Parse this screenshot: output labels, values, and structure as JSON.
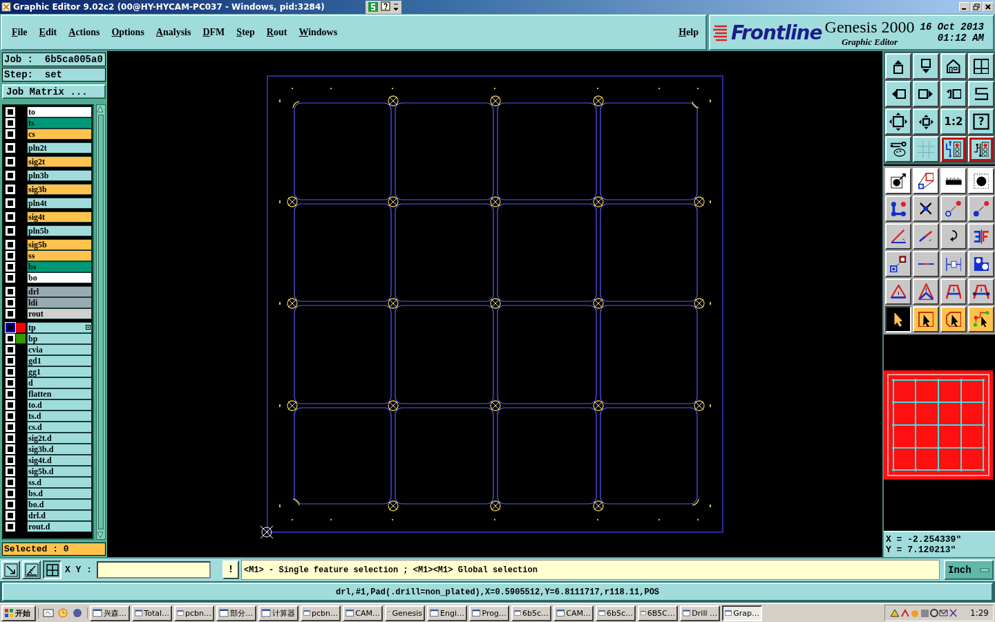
{
  "window": {
    "title": "Graphic Editor 9.02c2 (00@HY-HYCAM-PC037 - Windows, pid:3284)"
  },
  "menu": {
    "items": [
      "File",
      "Edit",
      "Actions",
      "Options",
      "Analysis",
      "DFM",
      "Step",
      "Rout",
      "Windows"
    ],
    "help": "Help"
  },
  "brand": {
    "logo": "Frontline",
    "product": "Genesis 2000",
    "subtitle": "Graphic Editor",
    "date": "16 Oct 2013",
    "time": "01:12 AM"
  },
  "job": {
    "job": "Job :  6b5ca005a0",
    "step": "Step:  set",
    "matrix_button": "Job Matrix ...",
    "selected": "Selected : 0"
  },
  "layer_groups": [
    {
      "layers": [
        {
          "name": "to",
          "color": "#ffffff",
          "checked": false
        },
        {
          "name": "ts",
          "color": "#009977",
          "checked": false
        },
        {
          "name": "cs",
          "color": "#ffc34d",
          "checked": false
        }
      ]
    },
    {
      "layers": [
        {
          "name": "pln2t",
          "color": "#a0dcdc",
          "checked": false
        }
      ]
    },
    {
      "layers": [
        {
          "name": "sig2t",
          "color": "#ffc34d",
          "checked": false
        }
      ]
    },
    {
      "layers": [
        {
          "name": "pln3b",
          "color": "#a0dcdc",
          "checked": false
        }
      ]
    },
    {
      "layers": [
        {
          "name": "sig3b",
          "color": "#ffc34d",
          "checked": false
        }
      ]
    },
    {
      "layers": [
        {
          "name": "pln4t",
          "color": "#a0dcdc",
          "checked": false
        }
      ]
    },
    {
      "layers": [
        {
          "name": "sig4t",
          "color": "#ffc34d",
          "checked": false
        }
      ]
    },
    {
      "layers": [
        {
          "name": "pln5b",
          "color": "#a0dcdc",
          "checked": false
        }
      ]
    },
    {
      "layers": [
        {
          "name": "sig5b",
          "color": "#ffc34d",
          "checked": false
        },
        {
          "name": "ss",
          "color": "#ffc34d",
          "checked": false
        },
        {
          "name": "bs",
          "color": "#009977",
          "checked": false
        },
        {
          "name": "bo",
          "color": "#ffffff",
          "checked": false
        }
      ]
    },
    {
      "layers": [
        {
          "name": "drl",
          "color": "#99aab0",
          "checked": false
        },
        {
          "name": "ldi",
          "color": "#99aab0",
          "checked": false
        },
        {
          "name": "rout",
          "color": "#d0d0d0",
          "checked": false
        }
      ]
    },
    {
      "layers": [
        {
          "name": "tp",
          "color": "#a0dcdc",
          "checked": false,
          "active": true,
          "swatch": {
            "color": "#ff0000"
          }
        },
        {
          "name": "bp",
          "color": "#a0dcdc",
          "checked": false,
          "active": false,
          "swatch": {
            "color": "#339900"
          }
        },
        {
          "name": "cvia",
          "color": "#a0dcdc",
          "checked": false
        },
        {
          "name": "gd1",
          "color": "#a0dcdc",
          "checked": false
        },
        {
          "name": "gg1",
          "color": "#a0dcdc",
          "checked": false
        },
        {
          "name": "d",
          "color": "#a0dcdc",
          "checked": false
        },
        {
          "name": "flatten",
          "color": "#a0dcdc",
          "checked": false
        },
        {
          "name": "to.d",
          "color": "#a0dcdc",
          "checked": false
        },
        {
          "name": "ts.d",
          "color": "#a0dcdc",
          "checked": false
        },
        {
          "name": "cs.d",
          "color": "#a0dcdc",
          "checked": false
        },
        {
          "name": "sig2t.d",
          "color": "#a0dcdc",
          "checked": false
        },
        {
          "name": "sig3b.d",
          "color": "#a0dcdc",
          "checked": false
        },
        {
          "name": "sig4t.d",
          "color": "#a0dcdc",
          "checked": false
        },
        {
          "name": "sig5b.d",
          "color": "#a0dcdc",
          "checked": false
        },
        {
          "name": "ss.d",
          "color": "#a0dcdc",
          "checked": false
        },
        {
          "name": "bs.d",
          "color": "#a0dcdc",
          "checked": false
        },
        {
          "name": "bo.d",
          "color": "#a0dcdc",
          "checked": false
        },
        {
          "name": "drl.d",
          "color": "#a0dcdc",
          "checked": false
        },
        {
          "name": "rout.d",
          "color": "#a0dcdc",
          "checked": false
        }
      ]
    }
  ],
  "tools": {
    "view": [
      {
        "kind": "pan-up",
        "on": false
      },
      {
        "kind": "pan-down",
        "on": false
      },
      {
        "kind": "home",
        "on": false
      },
      {
        "kind": "layout",
        "on": false
      },
      {
        "kind": "pan-left",
        "on": false
      },
      {
        "kind": "pan-right",
        "on": false
      },
      {
        "kind": "back",
        "on": false
      },
      {
        "kind": "route",
        "on": false
      },
      {
        "kind": "zoom-fit",
        "on": false
      },
      {
        "kind": "zoom-center",
        "on": false
      },
      {
        "kind": "ratio",
        "label": "1:2",
        "on": false
      },
      {
        "kind": "help",
        "label": "?",
        "on": false
      },
      {
        "kind": "settings",
        "on": false
      },
      {
        "kind": "grid",
        "on": false
      },
      {
        "kind": "circuit",
        "on": true
      },
      {
        "kind": "circuit-alt",
        "on": true
      }
    ],
    "edit": [
      {
        "kind": "move-dot",
        "selected": false
      },
      {
        "kind": "resize",
        "selected": false
      },
      {
        "kind": "ruler",
        "selected": false
      },
      {
        "kind": "dot-frame",
        "selected": false
      },
      {
        "kind": "nodes",
        "selected": false
      },
      {
        "kind": "cross-dot",
        "selected": false
      },
      {
        "kind": "ring-to-dot",
        "selected": false
      },
      {
        "kind": "dot-to-dot",
        "selected": false
      },
      {
        "kind": "angle-line",
        "selected": false
      },
      {
        "kind": "diagonal",
        "selected": false
      },
      {
        "kind": "rotate",
        "selected": false
      },
      {
        "kind": "mirror",
        "selected": false
      },
      {
        "kind": "square-scale",
        "selected": false
      },
      {
        "kind": "bar-line",
        "selected": false
      },
      {
        "kind": "dimension",
        "selected": false
      },
      {
        "kind": "shapes",
        "selected": false
      },
      {
        "kind": "triangle",
        "selected": false
      },
      {
        "kind": "triangle-double",
        "selected": false
      },
      {
        "kind": "arch",
        "selected": false
      },
      {
        "kind": "arch-cross",
        "selected": false
      },
      {
        "kind": "pointer",
        "selected": true
      },
      {
        "kind": "pointer-frame",
        "selected": false
      },
      {
        "kind": "pointer-octagon",
        "selected": false
      },
      {
        "kind": "pointer-net",
        "selected": false
      }
    ]
  },
  "coords": {
    "x": "X = -2.254339\"",
    "y": "Y = 7.120213\""
  },
  "command_bar": {
    "xy_label": "X Y :",
    "bang": "!",
    "message": "<M1> - Single feature selection ; <M1><M1> Global selection",
    "units": "Inch"
  },
  "status": "drl,#1,Pad(.drill=non_plated),X=0.5905512,Y=6.8111717,r118.11,POS",
  "taskbar": {
    "start": "开始",
    "tasks": [
      {
        "label": "兴森…",
        "selected": false
      },
      {
        "label": "Total…",
        "selected": false
      },
      {
        "label": "pcbn…",
        "selected": false
      },
      {
        "label": "部分…",
        "selected": false
      },
      {
        "label": "计算器",
        "selected": false
      },
      {
        "label": "pcbn…",
        "selected": false
      },
      {
        "label": "CAM…",
        "selected": false
      },
      {
        "label": "Genesis",
        "selected": false
      },
      {
        "label": "Engi…",
        "selected": false
      },
      {
        "label": "Prog…",
        "selected": false
      },
      {
        "label": "6b5c…",
        "selected": false
      },
      {
        "label": "CAM…",
        "selected": false
      },
      {
        "label": "6b5c…",
        "selected": false
      },
      {
        "label": "6B5C…",
        "selected": false
      },
      {
        "label": "Drill …",
        "selected": false
      },
      {
        "label": "Grap…",
        "selected": true
      }
    ],
    "clock": "1:29"
  }
}
